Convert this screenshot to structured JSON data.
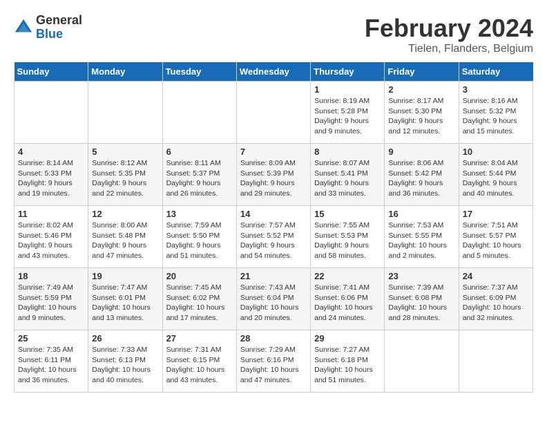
{
  "header": {
    "logo_general": "General",
    "logo_blue": "Blue",
    "main_title": "February 2024",
    "subtitle": "Tielen, Flanders, Belgium"
  },
  "days_of_week": [
    "Sunday",
    "Monday",
    "Tuesday",
    "Wednesday",
    "Thursday",
    "Friday",
    "Saturday"
  ],
  "weeks": [
    [
      {
        "day": "",
        "info": ""
      },
      {
        "day": "",
        "info": ""
      },
      {
        "day": "",
        "info": ""
      },
      {
        "day": "",
        "info": ""
      },
      {
        "day": "1",
        "info": "Sunrise: 8:19 AM\nSunset: 5:28 PM\nDaylight: 9 hours\nand 9 minutes."
      },
      {
        "day": "2",
        "info": "Sunrise: 8:17 AM\nSunset: 5:30 PM\nDaylight: 9 hours\nand 12 minutes."
      },
      {
        "day": "3",
        "info": "Sunrise: 8:16 AM\nSunset: 5:32 PM\nDaylight: 9 hours\nand 15 minutes."
      }
    ],
    [
      {
        "day": "4",
        "info": "Sunrise: 8:14 AM\nSunset: 5:33 PM\nDaylight: 9 hours\nand 19 minutes."
      },
      {
        "day": "5",
        "info": "Sunrise: 8:12 AM\nSunset: 5:35 PM\nDaylight: 9 hours\nand 22 minutes."
      },
      {
        "day": "6",
        "info": "Sunrise: 8:11 AM\nSunset: 5:37 PM\nDaylight: 9 hours\nand 26 minutes."
      },
      {
        "day": "7",
        "info": "Sunrise: 8:09 AM\nSunset: 5:39 PM\nDaylight: 9 hours\nand 29 minutes."
      },
      {
        "day": "8",
        "info": "Sunrise: 8:07 AM\nSunset: 5:41 PM\nDaylight: 9 hours\nand 33 minutes."
      },
      {
        "day": "9",
        "info": "Sunrise: 8:06 AM\nSunset: 5:42 PM\nDaylight: 9 hours\nand 36 minutes."
      },
      {
        "day": "10",
        "info": "Sunrise: 8:04 AM\nSunset: 5:44 PM\nDaylight: 9 hours\nand 40 minutes."
      }
    ],
    [
      {
        "day": "11",
        "info": "Sunrise: 8:02 AM\nSunset: 5:46 PM\nDaylight: 9 hours\nand 43 minutes."
      },
      {
        "day": "12",
        "info": "Sunrise: 8:00 AM\nSunset: 5:48 PM\nDaylight: 9 hours\nand 47 minutes."
      },
      {
        "day": "13",
        "info": "Sunrise: 7:59 AM\nSunset: 5:50 PM\nDaylight: 9 hours\nand 51 minutes."
      },
      {
        "day": "14",
        "info": "Sunrise: 7:57 AM\nSunset: 5:52 PM\nDaylight: 9 hours\nand 54 minutes."
      },
      {
        "day": "15",
        "info": "Sunrise: 7:55 AM\nSunset: 5:53 PM\nDaylight: 9 hours\nand 58 minutes."
      },
      {
        "day": "16",
        "info": "Sunrise: 7:53 AM\nSunset: 5:55 PM\nDaylight: 10 hours\nand 2 minutes."
      },
      {
        "day": "17",
        "info": "Sunrise: 7:51 AM\nSunset: 5:57 PM\nDaylight: 10 hours\nand 5 minutes."
      }
    ],
    [
      {
        "day": "18",
        "info": "Sunrise: 7:49 AM\nSunset: 5:59 PM\nDaylight: 10 hours\nand 9 minutes."
      },
      {
        "day": "19",
        "info": "Sunrise: 7:47 AM\nSunset: 6:01 PM\nDaylight: 10 hours\nand 13 minutes."
      },
      {
        "day": "20",
        "info": "Sunrise: 7:45 AM\nSunset: 6:02 PM\nDaylight: 10 hours\nand 17 minutes."
      },
      {
        "day": "21",
        "info": "Sunrise: 7:43 AM\nSunset: 6:04 PM\nDaylight: 10 hours\nand 20 minutes."
      },
      {
        "day": "22",
        "info": "Sunrise: 7:41 AM\nSunset: 6:06 PM\nDaylight: 10 hours\nand 24 minutes."
      },
      {
        "day": "23",
        "info": "Sunrise: 7:39 AM\nSunset: 6:08 PM\nDaylight: 10 hours\nand 28 minutes."
      },
      {
        "day": "24",
        "info": "Sunrise: 7:37 AM\nSunset: 6:09 PM\nDaylight: 10 hours\nand 32 minutes."
      }
    ],
    [
      {
        "day": "25",
        "info": "Sunrise: 7:35 AM\nSunset: 6:11 PM\nDaylight: 10 hours\nand 36 minutes."
      },
      {
        "day": "26",
        "info": "Sunrise: 7:33 AM\nSunset: 6:13 PM\nDaylight: 10 hours\nand 40 minutes."
      },
      {
        "day": "27",
        "info": "Sunrise: 7:31 AM\nSunset: 6:15 PM\nDaylight: 10 hours\nand 43 minutes."
      },
      {
        "day": "28",
        "info": "Sunrise: 7:29 AM\nSunset: 6:16 PM\nDaylight: 10 hours\nand 47 minutes."
      },
      {
        "day": "29",
        "info": "Sunrise: 7:27 AM\nSunset: 6:18 PM\nDaylight: 10 hours\nand 51 minutes."
      },
      {
        "day": "",
        "info": ""
      },
      {
        "day": "",
        "info": ""
      }
    ]
  ]
}
